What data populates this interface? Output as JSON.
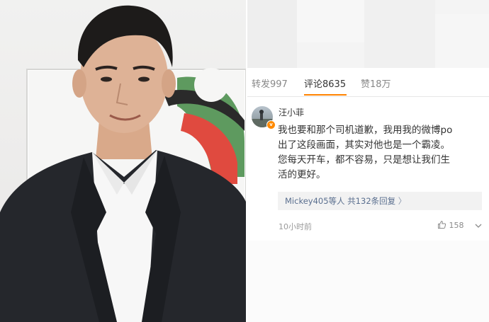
{
  "tabs": {
    "repost": "转发997",
    "comments": "评论8635",
    "likes": "赞18万"
  },
  "comment": {
    "username": "汪小菲",
    "verified_badge": "v",
    "text": "我也要和那个司机道歉，我用我的微博po\n出了这段画面，其实对他也是一个霸凌。\n您每天开车，都不容易，只是想让我们生\n活的更好。",
    "reply_users": "Mickey405等人",
    "reply_count": "共132条回复",
    "reply_chevron": "〉",
    "time": "10小时前",
    "likes": "158"
  },
  "colors": {
    "accent": "#ff8200",
    "link": "#5a6f8f",
    "suit": "#25272c"
  },
  "icons": [
    "thumbs-up-icon",
    "chevron-down-icon",
    "verified-v-icon"
  ]
}
